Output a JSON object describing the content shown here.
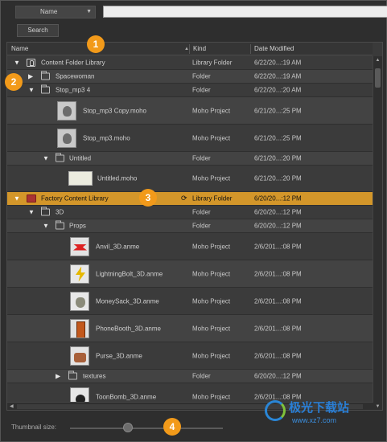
{
  "filter": {
    "field_label": "Name",
    "input_value": ""
  },
  "search_button": "Search",
  "columns": {
    "name": "Name",
    "kind": "Kind",
    "date": "Date Modified"
  },
  "rows": [
    {
      "name": "Content Folder Library",
      "kind": "Library Folder",
      "date": "6/22/20...:19 AM"
    },
    {
      "name": "Spacewoman",
      "kind": "Folder",
      "date": "6/22/20...:19 AM"
    },
    {
      "name": "Stop_mp3 4",
      "kind": "Folder",
      "date": "6/22/20...:20 AM"
    },
    {
      "name": "Stop_mp3 Copy.moho",
      "kind": "Moho Project",
      "date": "6/21/20...:25 PM"
    },
    {
      "name": "Stop_mp3.moho",
      "kind": "Moho Project",
      "date": "6/21/20...:25 PM"
    },
    {
      "name": "Untitled",
      "kind": "Folder",
      "date": "6/21/20...:20 PM"
    },
    {
      "name": "Untitled.moho",
      "kind": "Moho Project",
      "date": "6/21/20...:20 PM"
    },
    {
      "name": "Factory Content Library",
      "kind": "Library Folder",
      "date": "6/20/20...:12 PM"
    },
    {
      "name": "3D",
      "kind": "Folder",
      "date": "6/20/20...:12 PM"
    },
    {
      "name": "Props",
      "kind": "Folder",
      "date": "6/20/20...:12 PM"
    },
    {
      "name": "Anvil_3D.anme",
      "kind": "Moho Project",
      "date": "2/6/201...:08 PM"
    },
    {
      "name": "LightningBolt_3D.anme",
      "kind": "Moho Project",
      "date": "2/6/201...:08 PM"
    },
    {
      "name": "MoneySack_3D.anme",
      "kind": "Moho Project",
      "date": "2/6/201...:08 PM"
    },
    {
      "name": "PhoneBooth_3D.anme",
      "kind": "Moho Project",
      "date": "2/6/201...:08 PM"
    },
    {
      "name": "Purse_3D.anme",
      "kind": "Moho Project",
      "date": "2/6/201...:08 PM"
    },
    {
      "name": "textures",
      "kind": "Folder",
      "date": "6/20/20...:12 PM"
    },
    {
      "name": "ToonBomb_3D.anme",
      "kind": "Moho Project",
      "date": "2/6/201...:08 PM"
    }
  ],
  "thumbnail_size_label": "Thumbnail size:",
  "thumbnail_size_level": 0.38,
  "badges": [
    "1",
    "2",
    "3",
    "4"
  ],
  "watermark": {
    "title": "极光下载站",
    "url": "www.xz7.com"
  },
  "colors": {
    "selected_row": "#d3962a",
    "badge": "#f29a1a",
    "factory_icon": "#aa3333"
  }
}
